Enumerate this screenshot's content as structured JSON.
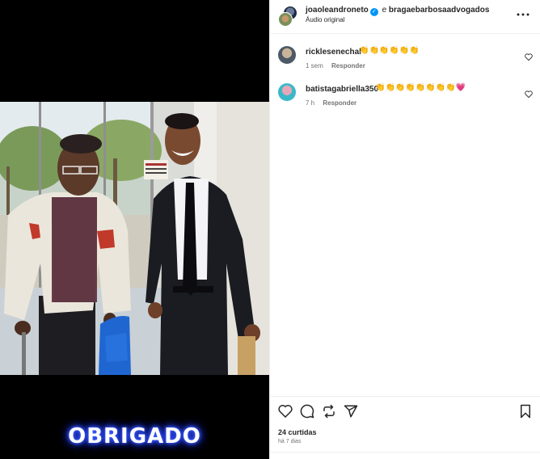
{
  "post": {
    "author": "joaoleandroneto",
    "joiner": "e",
    "coauthor": "bragaebarbosaadvogados",
    "audio": "Áudio original",
    "overlay_text": "OBRIGADO"
  },
  "comments": [
    {
      "username": "ricklesenechal",
      "text": "👏👏👏👏👏👏",
      "time": "1 sem",
      "reply": "Responder"
    },
    {
      "username": "batistagabriella350",
      "text": "👏👏👏👏👏👏👏👏💗",
      "time": "7 h",
      "reply": "Responder"
    }
  ],
  "footer": {
    "likes": "24 curtidas",
    "time": "há 7 dias"
  },
  "icons": {
    "like": "heart-icon",
    "comment": "comment-icon",
    "repost": "repost-icon",
    "share": "share-icon",
    "save": "bookmark-icon",
    "more": "more-icon"
  },
  "colors": {
    "verified": "#0095f6",
    "overlay_glow": "#2a44ff"
  }
}
